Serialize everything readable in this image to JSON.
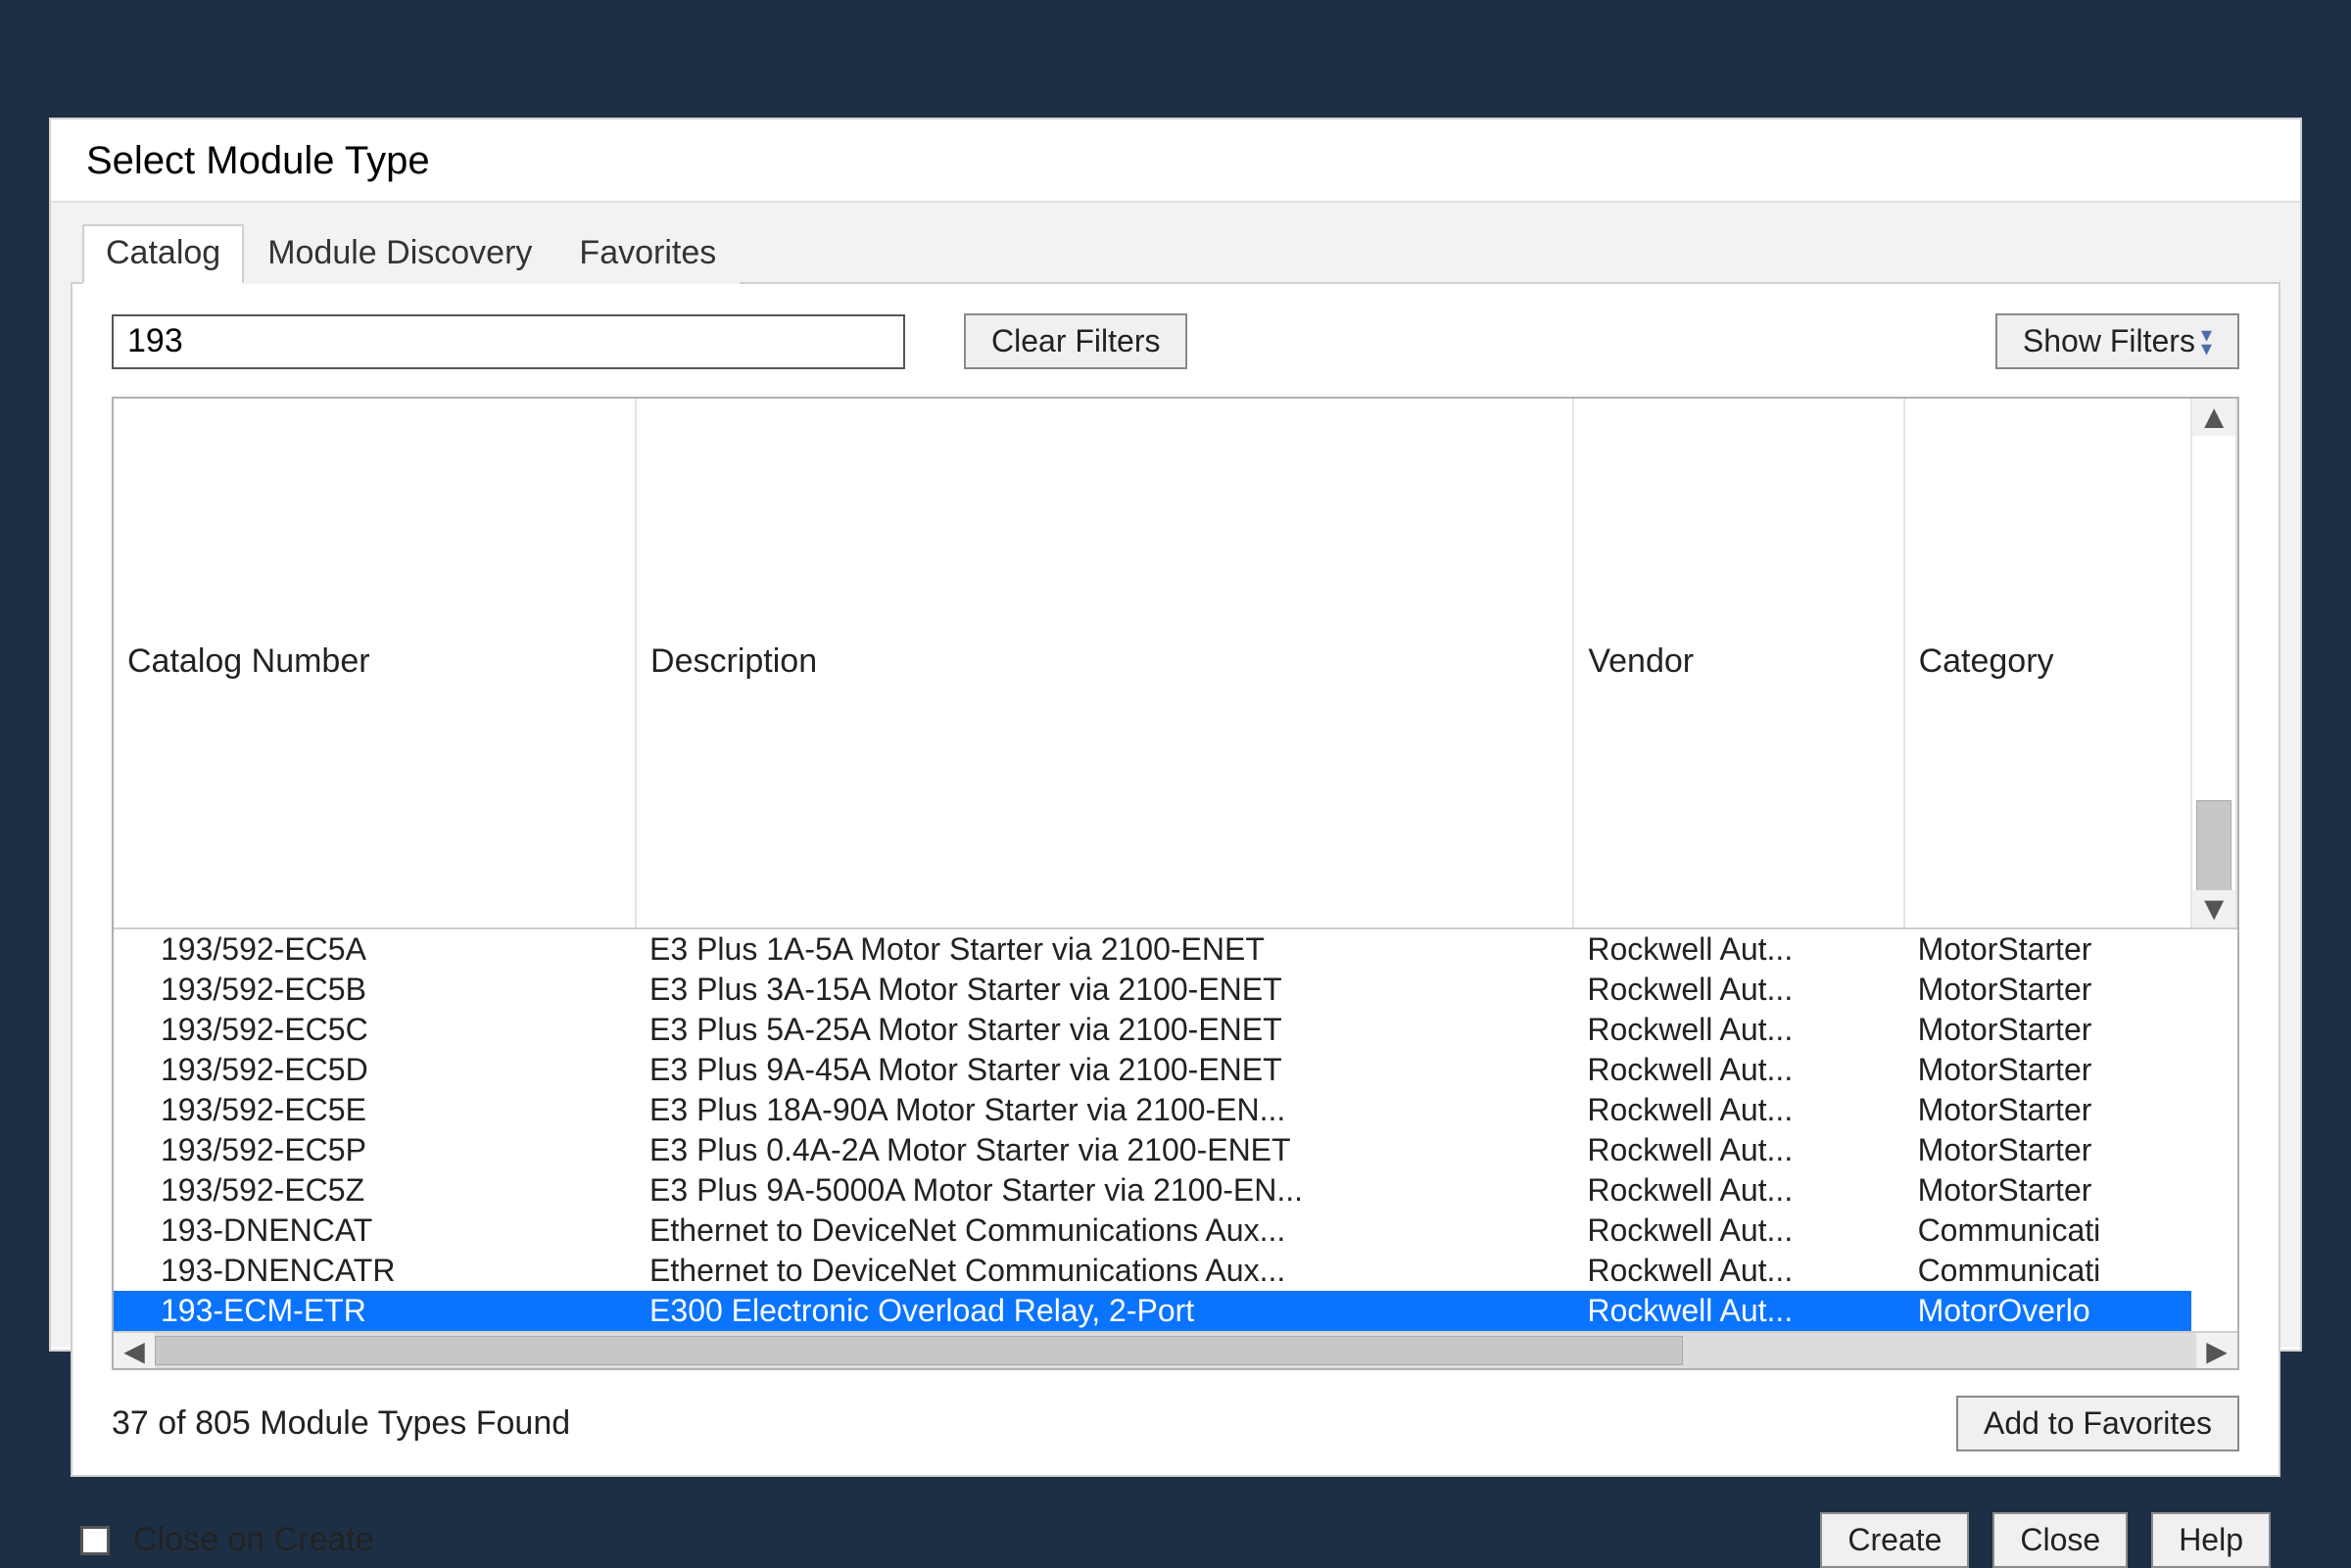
{
  "window": {
    "title": "Select Module Type"
  },
  "tabs": {
    "catalog": "Catalog",
    "discovery": "Module Discovery",
    "favorites": "Favorites",
    "active": "catalog"
  },
  "filters": {
    "search_value": "193",
    "clear_label": "Clear Filters",
    "show_label": "Show Filters"
  },
  "columns": {
    "catalog": "Catalog Number",
    "description": "Description",
    "vendor": "Vendor",
    "category": "Category"
  },
  "rows": [
    {
      "catalog": "193/592-EC5A",
      "description": "E3 Plus 1A-5A Motor Starter via 2100-ENET",
      "vendor": "Rockwell Aut...",
      "category": "MotorStarter",
      "selected": false
    },
    {
      "catalog": "193/592-EC5B",
      "description": "E3 Plus 3A-15A Motor Starter via 2100-ENET",
      "vendor": "Rockwell Aut...",
      "category": "MotorStarter",
      "selected": false
    },
    {
      "catalog": "193/592-EC5C",
      "description": "E3 Plus 5A-25A Motor Starter via 2100-ENET",
      "vendor": "Rockwell Aut...",
      "category": "MotorStarter",
      "selected": false
    },
    {
      "catalog": "193/592-EC5D",
      "description": "E3 Plus 9A-45A Motor Starter via 2100-ENET",
      "vendor": "Rockwell Aut...",
      "category": "MotorStarter",
      "selected": false
    },
    {
      "catalog": "193/592-EC5E",
      "description": "E3 Plus 18A-90A Motor Starter via 2100-EN...",
      "vendor": "Rockwell Aut...",
      "category": "MotorStarter",
      "selected": false
    },
    {
      "catalog": "193/592-EC5P",
      "description": "E3 Plus 0.4A-2A Motor Starter via 2100-ENET",
      "vendor": "Rockwell Aut...",
      "category": "MotorStarter",
      "selected": false
    },
    {
      "catalog": "193/592-EC5Z",
      "description": "E3 Plus 9A-5000A Motor Starter via 2100-EN...",
      "vendor": "Rockwell Aut...",
      "category": "MotorStarter",
      "selected": false
    },
    {
      "catalog": "193-DNENCAT",
      "description": "Ethernet to DeviceNet Communications Aux...",
      "vendor": "Rockwell Aut...",
      "category": "Communicati",
      "selected": false
    },
    {
      "catalog": "193-DNENCATR",
      "description": "Ethernet to DeviceNet Communications Aux...",
      "vendor": "Rockwell Aut...",
      "category": "Communicati",
      "selected": false
    },
    {
      "catalog": "193-ECM-ETR",
      "description": "E300 Electronic Overload Relay, 2-Port",
      "vendor": "Rockwell Aut...",
      "category": "MotorOverlo",
      "selected": true
    }
  ],
  "status": {
    "text": "37 of 805 Module Types Found"
  },
  "actions": {
    "add_favorites": "Add to Favorites",
    "create": "Create",
    "close": "Close",
    "help": "Help",
    "close_on_create": "Close on Create"
  }
}
